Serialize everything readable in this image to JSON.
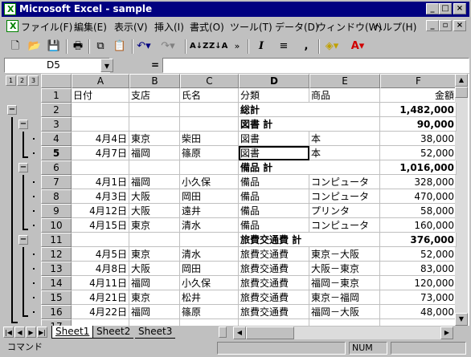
{
  "window": {
    "title": "Microsoft Excel - sample"
  },
  "menu": [
    "ファイル(F)",
    "編集(E)",
    "表示(V)",
    "挿入(I)",
    "書式(O)",
    "ツール(T)",
    "データ(D)",
    "ウィンドウ(W)",
    "ヘルプ(H)"
  ],
  "formula": {
    "cell_ref": "D5",
    "equals": "=",
    "content": ""
  },
  "outline_levels": [
    "1",
    "2",
    "3"
  ],
  "columns": [
    "A",
    "B",
    "C",
    "D",
    "E",
    "F"
  ],
  "selected_cell": "D5",
  "rows": [
    {
      "n": "1",
      "A": "日付",
      "B": "支店",
      "C": "氏名",
      "D": "分類",
      "E": "商品",
      "F": "金額",
      "bold": false
    },
    {
      "n": "2",
      "A": "",
      "B": "",
      "C": "",
      "D": "総計",
      "E": "",
      "F": "1,482,000",
      "bold": true
    },
    {
      "n": "3",
      "A": "",
      "B": "",
      "C": "",
      "D": "図書 計",
      "E": "",
      "F": "90,000",
      "bold": true
    },
    {
      "n": "4",
      "A": "4月4日",
      "B": "東京",
      "C": "柴田",
      "D": "図書",
      "E": "本",
      "F": "38,000",
      "bold": false
    },
    {
      "n": "5",
      "A": "4月7日",
      "B": "福岡",
      "C": "篠原",
      "D": "図書",
      "E": "本",
      "F": "52,000",
      "bold": false
    },
    {
      "n": "6",
      "A": "",
      "B": "",
      "C": "",
      "D": "備品 計",
      "E": "",
      "F": "1,016,000",
      "bold": true
    },
    {
      "n": "7",
      "A": "4月1日",
      "B": "福岡",
      "C": "小久保",
      "D": "備品",
      "E": "コンピュータ",
      "F": "328,000",
      "bold": false
    },
    {
      "n": "8",
      "A": "4月3日",
      "B": "大阪",
      "C": "岡田",
      "D": "備品",
      "E": "コンピュータ",
      "F": "470,000",
      "bold": false
    },
    {
      "n": "9",
      "A": "4月12日",
      "B": "大阪",
      "C": "遠井",
      "D": "備品",
      "E": "プリンタ",
      "F": "58,000",
      "bold": false
    },
    {
      "n": "10",
      "A": "4月15日",
      "B": "東京",
      "C": "清水",
      "D": "備品",
      "E": "コンピュータ",
      "F": "160,000",
      "bold": false
    },
    {
      "n": "11",
      "A": "",
      "B": "",
      "C": "",
      "D": "旅費交通費 計",
      "E": "",
      "F": "376,000",
      "bold": true
    },
    {
      "n": "12",
      "A": "4月5日",
      "B": "東京",
      "C": "清水",
      "D": "旅費交通費",
      "E": "東京－大阪",
      "F": "52,000",
      "bold": false
    },
    {
      "n": "13",
      "A": "4月8日",
      "B": "大阪",
      "C": "岡田",
      "D": "旅費交通費",
      "E": "大阪－東京",
      "F": "83,000",
      "bold": false
    },
    {
      "n": "14",
      "A": "4月11日",
      "B": "福岡",
      "C": "小久保",
      "D": "旅費交通費",
      "E": "福岡－東京",
      "F": "120,000",
      "bold": false
    },
    {
      "n": "15",
      "A": "4月21日",
      "B": "東京",
      "C": "松井",
      "D": "旅費交通費",
      "E": "東京－福岡",
      "F": "73,000",
      "bold": false
    },
    {
      "n": "16",
      "A": "4月22日",
      "B": "福岡",
      "C": "篠原",
      "D": "旅費交通費",
      "E": "福岡－大阪",
      "F": "48,000",
      "bold": false
    },
    {
      "n": "17",
      "A": "",
      "B": "",
      "C": "",
      "D": "",
      "E": "",
      "F": "",
      "bold": false
    }
  ],
  "tabs": [
    "Sheet1",
    "Sheet2",
    "Sheet3"
  ],
  "active_tab": "Sheet1",
  "status": {
    "mode": "コマンド",
    "num": "NUM"
  }
}
